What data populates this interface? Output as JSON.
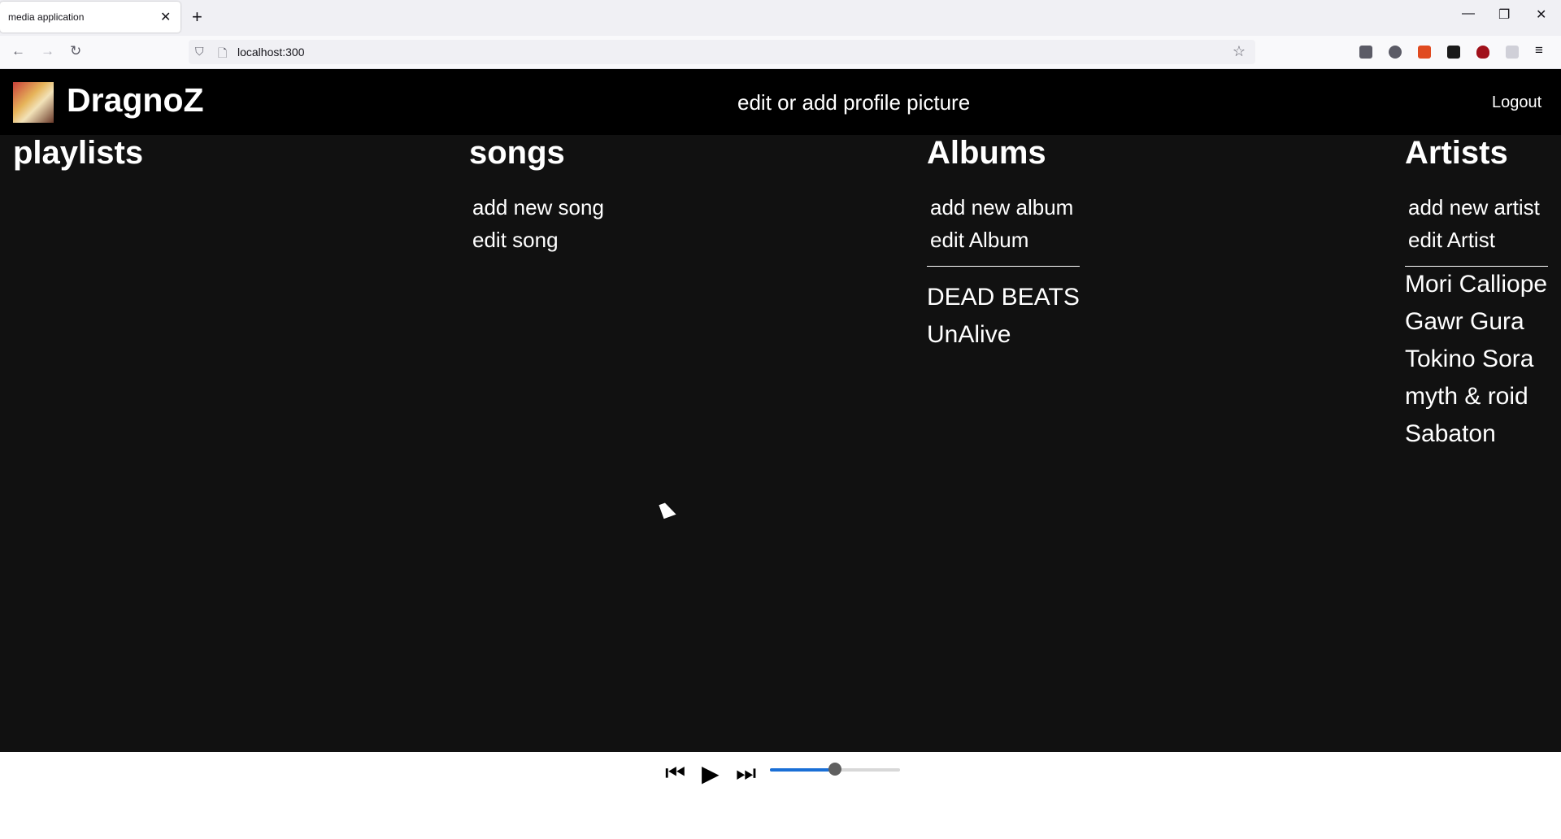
{
  "browser": {
    "tab_title": "media application",
    "tab_close": "✕",
    "new_tab": "+",
    "url": "localhost:300",
    "back": "←",
    "forward": "→",
    "reload": "↻",
    "minimize": "—",
    "restore": "❐",
    "close": "✕"
  },
  "header": {
    "username": "DragnoZ",
    "edit_profile": "edit or add profile picture",
    "logout": "Logout"
  },
  "columns": {
    "playlists": {
      "title": "playlists"
    },
    "songs": {
      "title": "songs",
      "links": [
        "add new song",
        "edit song"
      ]
    },
    "albums": {
      "title": "Albums",
      "links": [
        "add new album",
        "edit Album"
      ],
      "items": [
        "DEAD BEATS",
        "UnAlive"
      ]
    },
    "artists": {
      "title": "Artists",
      "links": [
        "add new artist",
        "edit Artist"
      ],
      "items": [
        "Mori Calliope",
        "Gawr Gura",
        "Tokino Sora",
        "myth & roid",
        "Sabaton"
      ]
    }
  },
  "player": {
    "prev": "⏮",
    "play": "▶",
    "next": "⏭",
    "volume": 0.5,
    "accent": "#1a6fd6"
  }
}
